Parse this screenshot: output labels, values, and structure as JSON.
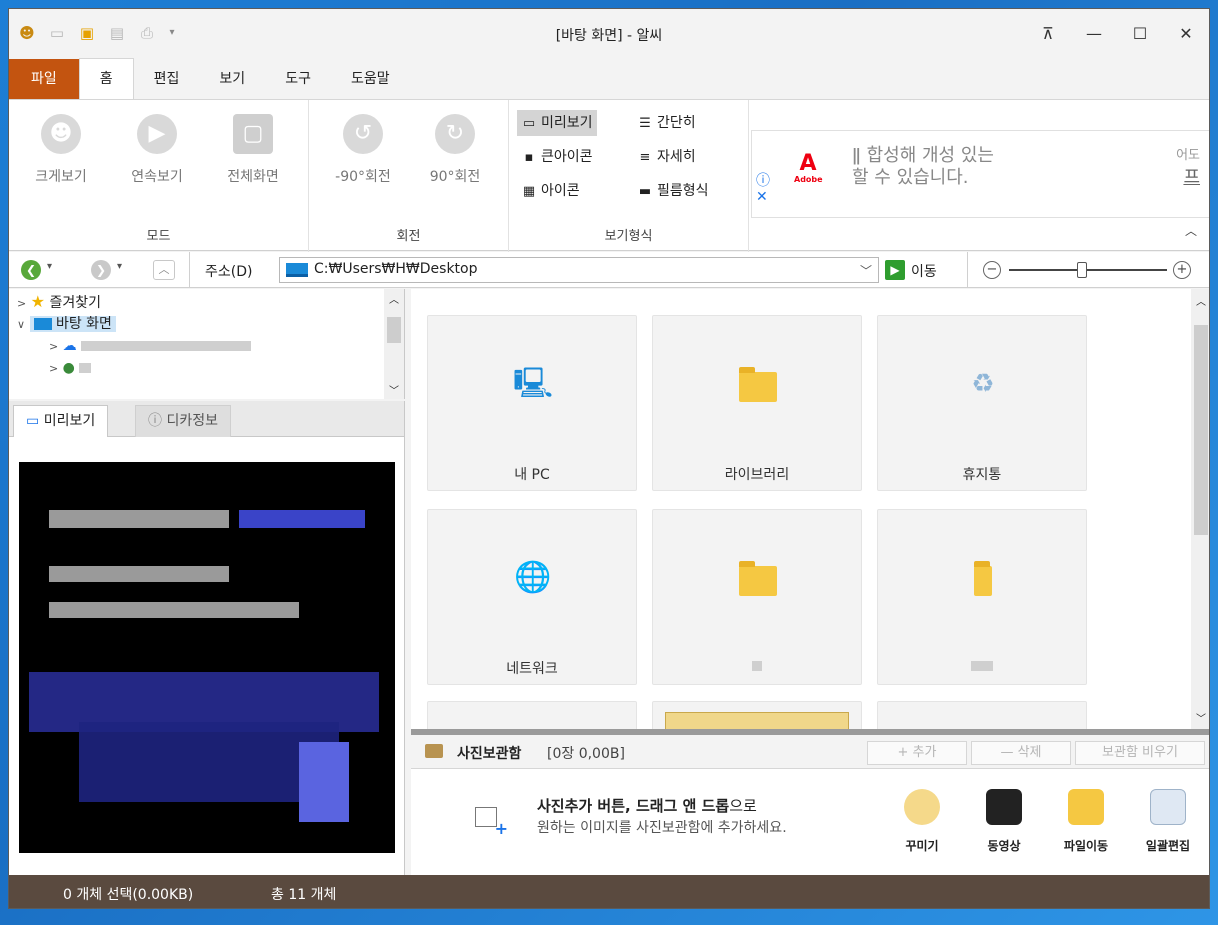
{
  "window": {
    "title": "[바탕 화면] - 알씨",
    "controls": {
      "pin": "⊼",
      "minimize": "—",
      "maximize": "☐",
      "close": "✕"
    }
  },
  "quick_access": [
    "app-icon",
    "folder-open-icon",
    "new-folder-icon",
    "save-icon",
    "print-icon",
    "customize-dropdown"
  ],
  "ribbon_tabs": [
    "파일",
    "홈",
    "편집",
    "보기",
    "도구",
    "도움말"
  ],
  "ribbon": {
    "mode": {
      "label": "모드",
      "buttons": [
        "크게보기",
        "연속보기",
        "전체화면"
      ]
    },
    "rotate": {
      "label": "회전",
      "buttons": [
        "-90°회전",
        "90°회전"
      ]
    },
    "view": {
      "label": "보기형식",
      "options": [
        "미리보기",
        "간단히",
        "큰아이콘",
        "자세히",
        "아이콘",
        "필름형식"
      ],
      "selected": "미리보기"
    },
    "ad": {
      "logo": "A",
      "logo_sub": "Adobe",
      "text1": "ǁ 합성해 개성 있는",
      "text2": "할 수 있습니다.",
      "right1": "어도",
      "right2": "프"
    }
  },
  "address": {
    "label": "주소(D)",
    "label_key": "D",
    "value": "C:₩Users₩H₩Desktop",
    "go_label": "이동"
  },
  "tree": {
    "items": [
      "즐겨찾기",
      "바탕 화면"
    ]
  },
  "preview_tabs": [
    "미리보기",
    "디카정보"
  ],
  "main": {
    "tiles": [
      "내 PC",
      "라이브러리",
      "휴지통",
      "네트워크",
      "",
      ""
    ]
  },
  "photo_box": {
    "title": "사진보관함",
    "info": "[0장 0,00B]",
    "buttons": [
      "+ 추가",
      "— 삭제",
      "보관함 비우기"
    ],
    "hint_bold": "사진추가 버튼, 드래그 앤 드롭",
    "hint_tail": "으로",
    "hint_line2": "원하는 이미지를 사진보관함에 추가하세요.",
    "tools": [
      "꾸미기",
      "동영상",
      "파일이동",
      "일괄편집"
    ]
  },
  "status": {
    "selected": "0 개체 선택(0.00KB)",
    "total": "총 11 개체"
  },
  "colors": {
    "file_tab": "#c35410",
    "status_bar": "#5a4a3f",
    "selection": "#cce4f7",
    "desktop": "#1a6fc4"
  }
}
